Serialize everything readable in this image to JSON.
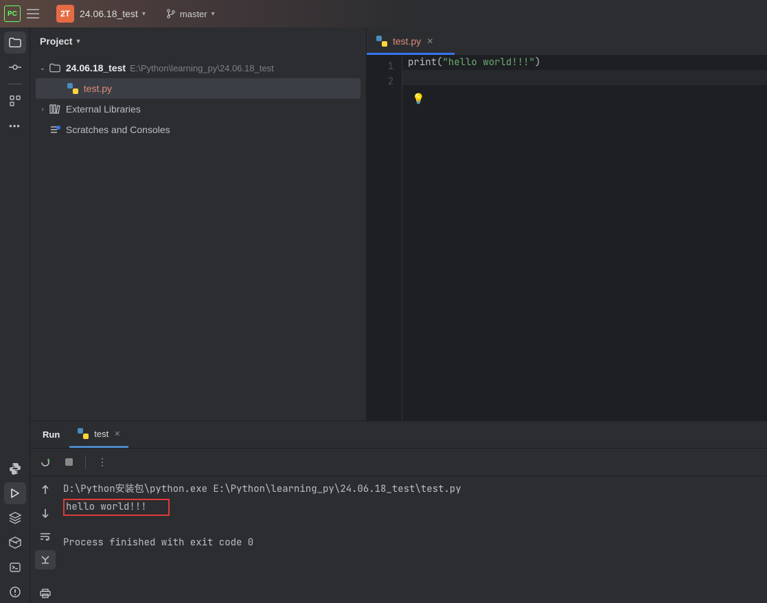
{
  "titlebar": {
    "project_badge": "2T",
    "project_name": "24.06.18_test",
    "branch_name": "master"
  },
  "sidebar": {
    "title": "Project",
    "root_name": "24.06.18_test",
    "root_path": "E:\\Python\\learning_py\\24.06.18_test",
    "file_selected": "test.py",
    "external_libraries": "External Libraries",
    "scratches": "Scratches and Consoles"
  },
  "editor": {
    "tab_label": "test.py",
    "line_numbers": [
      "1",
      "2"
    ],
    "code": {
      "fn": "print",
      "open": "(",
      "str": "\"hello world!!!\"",
      "close": ")"
    }
  },
  "run": {
    "title": "Run",
    "tab_label": "test",
    "console_cmd": "D:\\Python安装包\\python.exe E:\\Python\\learning_py\\24.06.18_test\\test.py",
    "console_out": "hello world!!!",
    "console_exit": "Process finished with exit code 0"
  }
}
